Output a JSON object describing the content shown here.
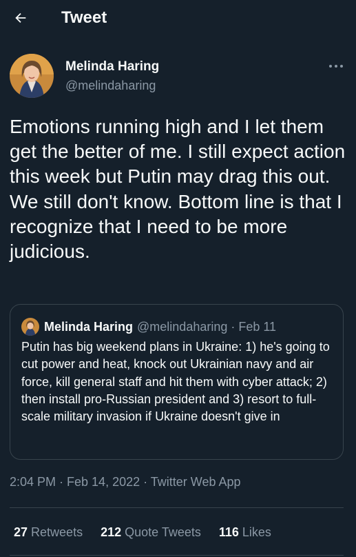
{
  "header": {
    "title": "Tweet",
    "back_icon": "arrow-left-icon"
  },
  "tweet": {
    "author_name": "Melinda Haring",
    "author_handle": "@melindaharing",
    "more_icon": "more-horizontal-icon",
    "text": "Emotions running high and I let them get the better of me. I still expect action this week but Putin may drag this out. We still don't know. Bottom line is that I recognize that I need to be more judicious.",
    "timestamp": "2:04 PM · Feb 14, 2022 · Twitter Web App"
  },
  "quoted_tweet": {
    "author_name": "Melinda Haring",
    "meta": "@melindaharing · Feb 11",
    "text": "Putin has big weekend plans in Ukraine: 1) he's going to cut power and heat, knock out Ukrainian navy and air force, kill general staff and hit them with cyber attack; 2) then install pro-Russian president and 3) resort to full-scale military invasion if Ukraine doesn't give in"
  },
  "stats": [
    {
      "count": "27",
      "label": "Retweets"
    },
    {
      "count": "212",
      "label": "Quote Tweets"
    },
    {
      "count": "116",
      "label": "Likes"
    }
  ],
  "colors": {
    "background": "#15202b",
    "text_primary": "#f7f9f9",
    "text_secondary": "#8b98a5",
    "border": "#38444d"
  }
}
